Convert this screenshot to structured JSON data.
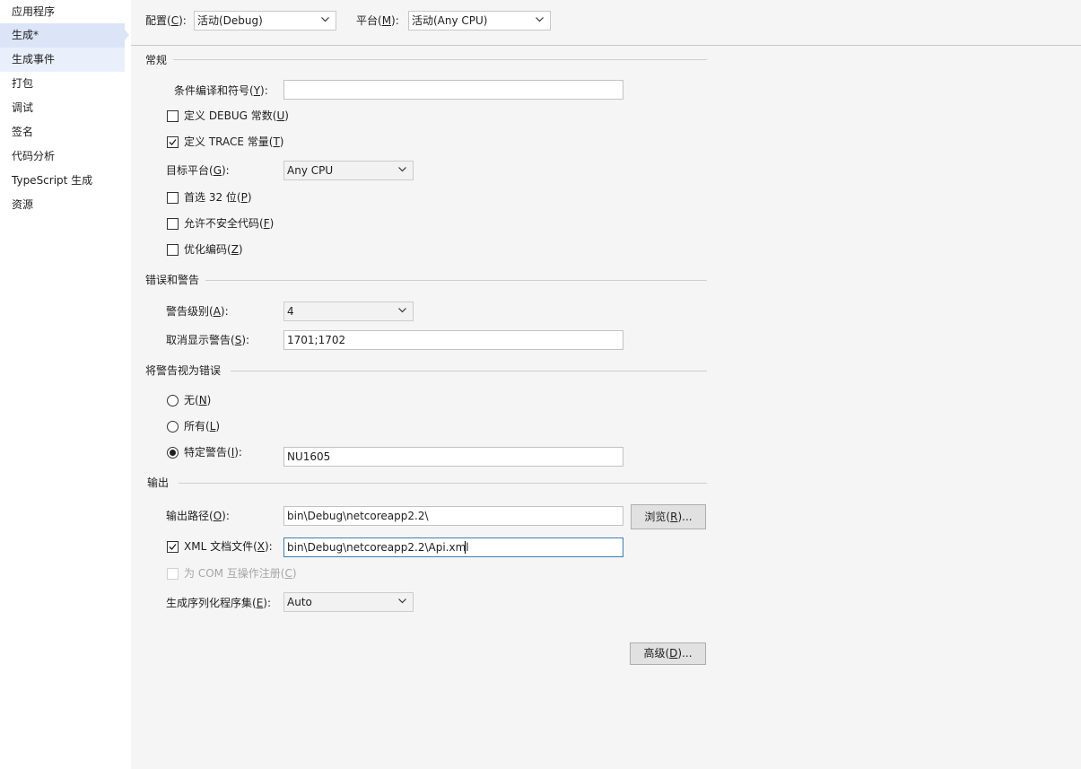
{
  "sidebar": {
    "items": [
      {
        "label": "应用程序"
      },
      {
        "label": "生成*"
      },
      {
        "label": "生成事件"
      },
      {
        "label": "打包"
      },
      {
        "label": "调试"
      },
      {
        "label": "签名"
      },
      {
        "label": "代码分析"
      },
      {
        "label": "TypeScript 生成"
      },
      {
        "label": "资源"
      }
    ]
  },
  "toolbar": {
    "config_label": "配置(",
    "config_key": "C",
    "config_suffix": "):",
    "config_value": "活动(Debug)",
    "platform_label": "平台(",
    "platform_key": "M",
    "platform_suffix": "):",
    "platform_value": "活动(Any CPU)"
  },
  "general": {
    "header": "常规",
    "symbols_label": "条件编译和符号(",
    "symbols_key": "Y",
    "symbols_suffix": "):",
    "symbols_value": "",
    "debug_label": "定义 DEBUG 常数(",
    "debug_key": "U",
    "debug_suffix": ")",
    "trace_label": "定义 TRACE 常量(",
    "trace_key": "T",
    "trace_suffix": ")",
    "target_label": "目标平台(",
    "target_key": "G",
    "target_suffix": "):",
    "target_value": "Any CPU",
    "prefer32_label": "首选 32 位(",
    "prefer32_key": "P",
    "prefer32_suffix": ")",
    "unsafe_label": "允许不安全代码(",
    "unsafe_key": "F",
    "unsafe_suffix": ")",
    "optimize_label": "优化编码(",
    "optimize_key": "Z",
    "optimize_suffix": ")"
  },
  "errors": {
    "header": "错误和警告",
    "level_label": "警告级别(",
    "level_key": "A",
    "level_suffix": "):",
    "level_value": "4",
    "suppress_label": "取消显示警告(",
    "suppress_key": "S",
    "suppress_suffix": "):",
    "suppress_value": "1701;1702"
  },
  "treat": {
    "header": "将警告视为错误",
    "none_label": "无(",
    "none_key": "N",
    "none_suffix": ")",
    "all_label": "所有(",
    "all_key": "L",
    "all_suffix": ")",
    "specific_label": "特定警告(",
    "specific_key": "I",
    "specific_suffix": "):",
    "specific_value": "NU1605"
  },
  "output": {
    "header": "输出",
    "path_label": "输出路径(",
    "path_key": "O",
    "path_suffix": "):",
    "path_value": "bin\\Debug\\netcoreapp2.2\\",
    "browse_label": "浏览(",
    "browse_key": "R",
    "browse_suffix": ")...",
    "xml_label": "XML 文档文件(",
    "xml_key": "X",
    "xml_suffix": "):",
    "xml_value": "bin\\Debug\\netcoreapp2.2\\Api.xml",
    "com_label": "为 COM 互操作注册(",
    "com_key": "C",
    "com_suffix": ")",
    "serial_label": "生成序列化程序集(",
    "serial_key": "E",
    "serial_suffix": "):",
    "serial_value": "Auto"
  },
  "advanced": {
    "label": "高级(",
    "key": "D",
    "suffix": ")..."
  }
}
